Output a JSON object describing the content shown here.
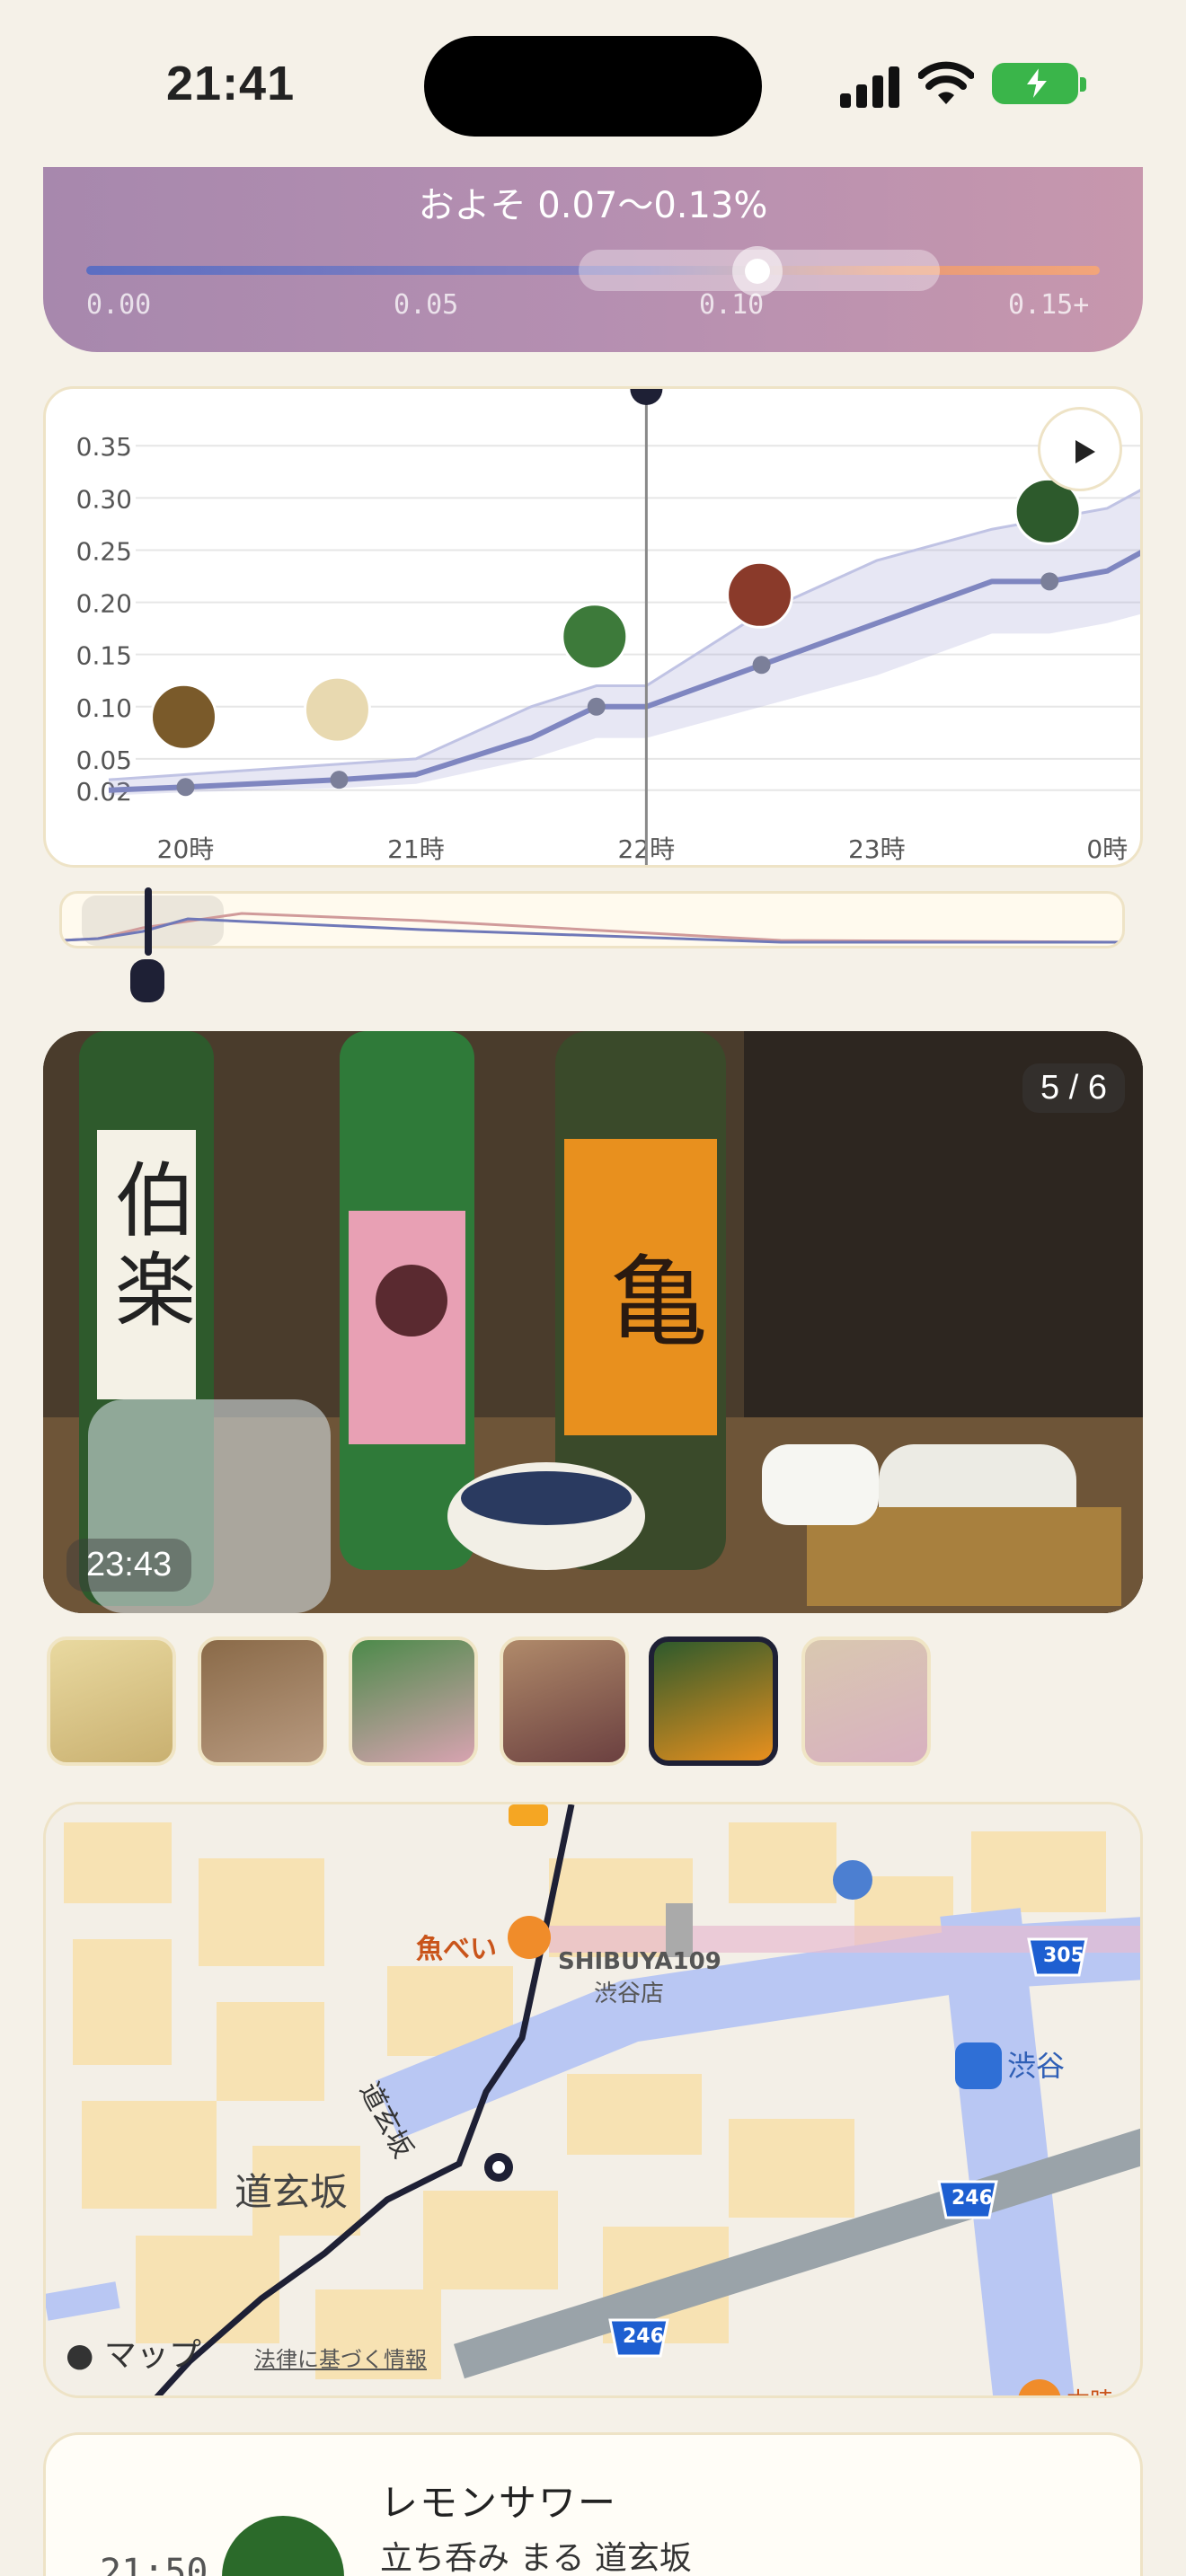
{
  "status": {
    "time": "21:41"
  },
  "bac": {
    "approx_label": "およそ 0.07〜0.13%",
    "ticks": [
      "0.00",
      "0.05",
      "0.10",
      "0.15+"
    ],
    "range": [
      0.07,
      0.13
    ]
  },
  "chart_data": {
    "type": "line",
    "x": [
      "19:40",
      "20:00",
      "20:40",
      "21:00",
      "21:30",
      "21:47",
      "22:00",
      "22:30",
      "23:00",
      "23:30",
      "23:45",
      "0:00",
      "0:10"
    ],
    "xticks": [
      "20時",
      "21時",
      "22時",
      "23時",
      "0時"
    ],
    "yticks": [
      "0.35",
      "0.30",
      "0.25",
      "0.20",
      "0.15",
      "0.10",
      "0.05",
      "0.02"
    ],
    "ylim": [
      0,
      0.37
    ],
    "series": [
      {
        "values": [
          0.02,
          0.023,
          0.03,
          0.035,
          0.07,
          0.1,
          0.1,
          0.14,
          0.18,
          0.22,
          0.22,
          0.23,
          0.25
        ]
      }
    ],
    "band_low": [
      0.015,
      0.018,
      0.022,
      0.026,
      0.05,
      0.07,
      0.07,
      0.1,
      0.13,
      0.17,
      0.17,
      0.18,
      0.19
    ],
    "band_high": [
      0.03,
      0.035,
      0.045,
      0.05,
      0.1,
      0.12,
      0.12,
      0.19,
      0.24,
      0.27,
      0.28,
      0.29,
      0.31
    ],
    "markers": [
      "20:00",
      "20:40",
      "21:47",
      "22:30",
      "23:45"
    ],
    "current_time": "22:00",
    "grid": true
  },
  "photo": {
    "counter": "5 / 6",
    "time": "23:43"
  },
  "map": {
    "labels": {
      "uobei": "魚べい",
      "shibuya109": "SHIBUYA109",
      "shibuya109_sub": "渋谷店",
      "shibuya_station": "渋谷",
      "dogenzaka_street": "道玄坂",
      "dogenzaka_area": "道玄坂",
      "route305": "305",
      "route246a": "246",
      "route246b": "246",
      "apple_maps": "マップ",
      "legal": "法律に基づく情報",
      "cut_label": "本時"
    }
  },
  "list": {
    "time": "21:50",
    "title": "レモンサワー",
    "place": "立ち呑み まる 道玄坂"
  }
}
